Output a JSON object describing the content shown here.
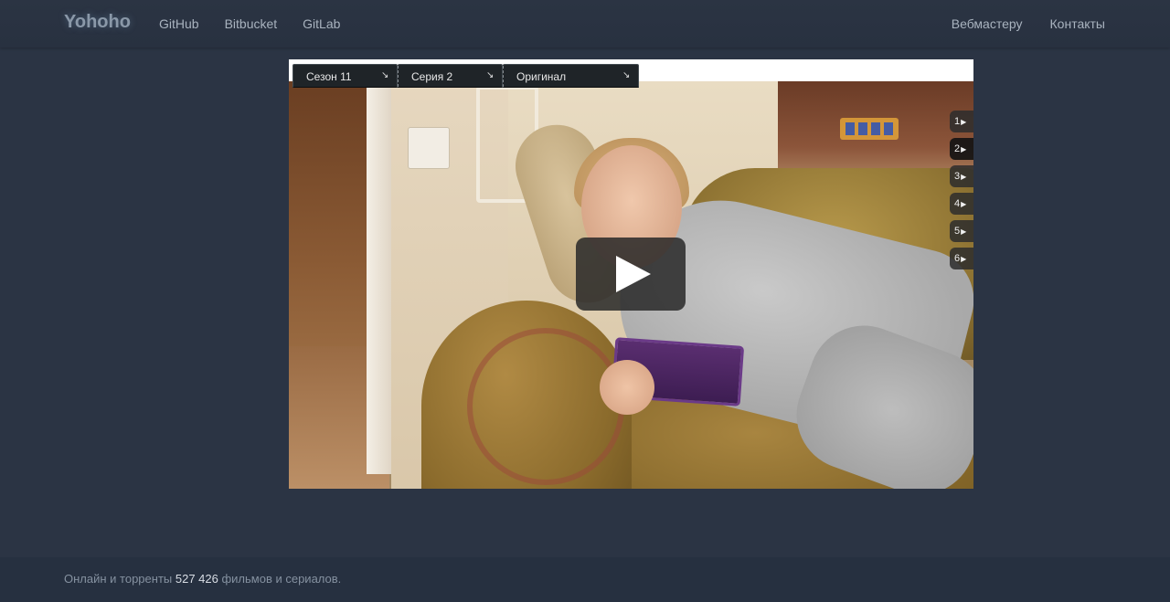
{
  "header": {
    "brand": "Yohoho",
    "nav_left": [
      {
        "label": "GitHub"
      },
      {
        "label": "Bitbucket"
      },
      {
        "label": "GitLab"
      }
    ],
    "nav_right": [
      {
        "label": "Вебмастеру"
      },
      {
        "label": "Контакты"
      }
    ]
  },
  "player": {
    "selects": [
      {
        "label": "Сезон 11"
      },
      {
        "label": "Серия 2"
      },
      {
        "label": "Оригинал"
      }
    ],
    "episodes": [
      {
        "number": "1",
        "active": false
      },
      {
        "number": "2",
        "active": true
      },
      {
        "number": "3",
        "active": false
      },
      {
        "number": "4",
        "active": false
      },
      {
        "number": "5",
        "active": false
      },
      {
        "number": "6",
        "active": false
      }
    ],
    "episode_arrow": "▶",
    "play_icon": "play-icon"
  },
  "footer": {
    "prefix": "Онлайн и торренты ",
    "count": "527 426",
    "suffix": " фильмов и сериалов."
  },
  "colors": {
    "page_bg": "#2b3444",
    "footer_bg": "#263040",
    "player_bg": "#ffffff",
    "select_bg": "#1f2428"
  }
}
